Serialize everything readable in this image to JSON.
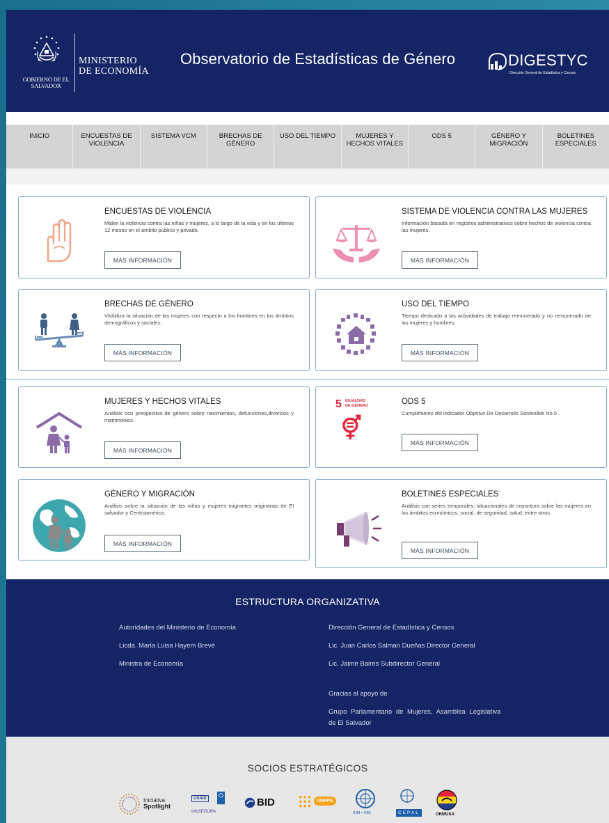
{
  "header": {
    "gov_text": "GOBIERNO DE EL SALVADOR",
    "ministry_line1": "MINISTERIO",
    "ministry_line2": "DE ECONOMÍA",
    "site_title": "Observatorio de Estadísticas de Género",
    "digestyc_name": "DIGESTYC",
    "digestyc_sub": "Dirección General de Estadística y Censos"
  },
  "nav": [
    {
      "label": "INICIO"
    },
    {
      "label": "ENCUESTAS DE VIOLENCIA"
    },
    {
      "label": "SISTEMA VCM"
    },
    {
      "label": "BRECHAS DE GÉNERO"
    },
    {
      "label": "USO DEL TIEMPO"
    },
    {
      "label": "MUJERES Y HECHOS VITALES"
    },
    {
      "label": "ODS 5"
    },
    {
      "label": "GÉNERO Y MIGRACIÓN"
    },
    {
      "label": "BOLETINES ESPECIALES"
    }
  ],
  "cards": [
    {
      "title": "ENCUESTAS DE VIOLENCIA",
      "desc": "Miden la violencia contra las niñas y mujeres, a lo largo de la vida y en los últimos 12 meses en el ámbito público y privado.",
      "button": "MÁS INFORMACIÓN",
      "icon": "raised-hand-icon"
    },
    {
      "title": "SISTEMA DE VIOLENCIA CONTRA LAS MUJERES",
      "desc": "Información basada en registros administrativos sobre hechos de violencia contra las mujeres.",
      "button": "MÁS INFORMACIÓN",
      "icon": "justice-scale-hands-icon"
    },
    {
      "title": "BRECHAS DE GÉNERO",
      "desc": "Visibiliza la situación de las mujeres con respecto a los hombres en los ámbitos demográficos y sociales.",
      "button": "MÁS INFORMACIÓN",
      "icon": "gender-balance-icon"
    },
    {
      "title": "USO DEL TIEMPO",
      "desc": "Tiempo dedicado a las actividades de trabajo remunerado y no remunerado de las mujeres y hombres.",
      "button": "MÁS INFORMACIÓN",
      "icon": "household-activities-icon"
    },
    {
      "title": "MUJERES Y HECHOS VITALES",
      "desc": "Análisis con prespectiva de género sobre nacimientos, defunciones,divorcios y matrimonios.",
      "button": "MÁS INFORMACIÓN",
      "icon": "family-home-icon"
    },
    {
      "title": "ODS 5",
      "desc": "Cumplimiento del indicador Objetivo De Desarrollo Sostenible No.5 .",
      "button": "MÁS INFORMACIÓN",
      "icon": "sdg5-gender-equality-icon",
      "badge_num": "5",
      "badge_text": "IGUALDAD DE GÉNERO"
    },
    {
      "title": "GÉNERO Y MIGRACIÓN",
      "desc": "Análisis sobre la situación de las niñas y mujeres migrantes originarias de El salvador y Centroamérica.",
      "button": "MÁS INFORMACIÓN",
      "icon": "globe-family-icon"
    },
    {
      "title": "BOLETINES ESPECIALES",
      "desc": "Análisis con series temporales; situacionales de coyuntura sobre las mujeres en los ámbitos económicos, social, de seguridad, salud, entre otros.",
      "button": "MÁS INFORMACIÓN",
      "icon": "megaphone-icon"
    }
  ],
  "footer": {
    "heading": "ESTRUCTURA ORGANIZATIVA",
    "left": [
      "Autoridades del Ministerio de Economía",
      "Licda. María Luisa Hayem Brevé",
      "Ministra de Economía"
    ],
    "right": [
      "Dirección General de Estadística y Censos",
      "Lic. Juan Carlos Salman Dueñas Director General",
      "Lic. Jaime Baires Subdirector General"
    ],
    "thanks": "Gracias al apoyo de",
    "support_line1": "Grupo Parlamentario de Mujeres, Asamblea Legislativa",
    "support_line2": "de El Salvador"
  },
  "partners": {
    "heading": "SOCIOS ESTRATÉGICOS",
    "spotlight_line1": "Iniciativa",
    "spotlight_line2": "Spotlight",
    "usaid": "USAID",
    "infosegura": "infoSEGURA",
    "bid": "BID",
    "unfpa": "UNFPA",
    "iom": "IOM • OIM",
    "cepal": "CEPAL",
    "ormusa": "ORMUSA"
  },
  "colors": {
    "navy": "#142465",
    "nav_gray": "#d4d4d4",
    "card_border": "#7fa9d8",
    "icon_purple": "#8b6aa8",
    "icon_salmon": "#f2a58a",
    "icon_pink": "#ec8fb2",
    "sdg_red": "#e5243b",
    "globe_teal": "#3ea7ad"
  }
}
